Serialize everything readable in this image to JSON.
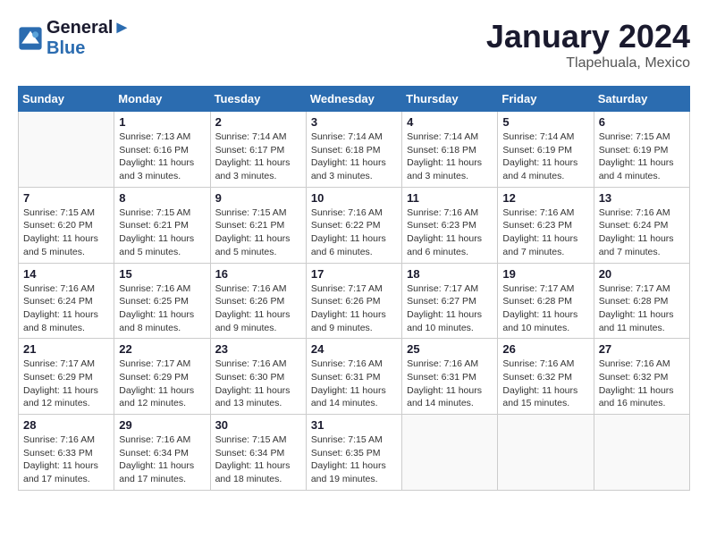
{
  "header": {
    "logo_line1": "General",
    "logo_line2": "Blue",
    "month": "January 2024",
    "location": "Tlapehuala, Mexico"
  },
  "columns": [
    "Sunday",
    "Monday",
    "Tuesday",
    "Wednesday",
    "Thursday",
    "Friday",
    "Saturday"
  ],
  "weeks": [
    [
      {
        "day": "",
        "sunrise": "",
        "sunset": "",
        "daylight": ""
      },
      {
        "day": "1",
        "sunrise": "Sunrise: 7:13 AM",
        "sunset": "Sunset: 6:16 PM",
        "daylight": "Daylight: 11 hours and 3 minutes."
      },
      {
        "day": "2",
        "sunrise": "Sunrise: 7:14 AM",
        "sunset": "Sunset: 6:17 PM",
        "daylight": "Daylight: 11 hours and 3 minutes."
      },
      {
        "day": "3",
        "sunrise": "Sunrise: 7:14 AM",
        "sunset": "Sunset: 6:18 PM",
        "daylight": "Daylight: 11 hours and 3 minutes."
      },
      {
        "day": "4",
        "sunrise": "Sunrise: 7:14 AM",
        "sunset": "Sunset: 6:18 PM",
        "daylight": "Daylight: 11 hours and 3 minutes."
      },
      {
        "day": "5",
        "sunrise": "Sunrise: 7:14 AM",
        "sunset": "Sunset: 6:19 PM",
        "daylight": "Daylight: 11 hours and 4 minutes."
      },
      {
        "day": "6",
        "sunrise": "Sunrise: 7:15 AM",
        "sunset": "Sunset: 6:19 PM",
        "daylight": "Daylight: 11 hours and 4 minutes."
      }
    ],
    [
      {
        "day": "7",
        "sunrise": "Sunrise: 7:15 AM",
        "sunset": "Sunset: 6:20 PM",
        "daylight": "Daylight: 11 hours and 5 minutes."
      },
      {
        "day": "8",
        "sunrise": "Sunrise: 7:15 AM",
        "sunset": "Sunset: 6:21 PM",
        "daylight": "Daylight: 11 hours and 5 minutes."
      },
      {
        "day": "9",
        "sunrise": "Sunrise: 7:15 AM",
        "sunset": "Sunset: 6:21 PM",
        "daylight": "Daylight: 11 hours and 5 minutes."
      },
      {
        "day": "10",
        "sunrise": "Sunrise: 7:16 AM",
        "sunset": "Sunset: 6:22 PM",
        "daylight": "Daylight: 11 hours and 6 minutes."
      },
      {
        "day": "11",
        "sunrise": "Sunrise: 7:16 AM",
        "sunset": "Sunset: 6:23 PM",
        "daylight": "Daylight: 11 hours and 6 minutes."
      },
      {
        "day": "12",
        "sunrise": "Sunrise: 7:16 AM",
        "sunset": "Sunset: 6:23 PM",
        "daylight": "Daylight: 11 hours and 7 minutes."
      },
      {
        "day": "13",
        "sunrise": "Sunrise: 7:16 AM",
        "sunset": "Sunset: 6:24 PM",
        "daylight": "Daylight: 11 hours and 7 minutes."
      }
    ],
    [
      {
        "day": "14",
        "sunrise": "Sunrise: 7:16 AM",
        "sunset": "Sunset: 6:24 PM",
        "daylight": "Daylight: 11 hours and 8 minutes."
      },
      {
        "day": "15",
        "sunrise": "Sunrise: 7:16 AM",
        "sunset": "Sunset: 6:25 PM",
        "daylight": "Daylight: 11 hours and 8 minutes."
      },
      {
        "day": "16",
        "sunrise": "Sunrise: 7:16 AM",
        "sunset": "Sunset: 6:26 PM",
        "daylight": "Daylight: 11 hours and 9 minutes."
      },
      {
        "day": "17",
        "sunrise": "Sunrise: 7:17 AM",
        "sunset": "Sunset: 6:26 PM",
        "daylight": "Daylight: 11 hours and 9 minutes."
      },
      {
        "day": "18",
        "sunrise": "Sunrise: 7:17 AM",
        "sunset": "Sunset: 6:27 PM",
        "daylight": "Daylight: 11 hours and 10 minutes."
      },
      {
        "day": "19",
        "sunrise": "Sunrise: 7:17 AM",
        "sunset": "Sunset: 6:28 PM",
        "daylight": "Daylight: 11 hours and 10 minutes."
      },
      {
        "day": "20",
        "sunrise": "Sunrise: 7:17 AM",
        "sunset": "Sunset: 6:28 PM",
        "daylight": "Daylight: 11 hours and 11 minutes."
      }
    ],
    [
      {
        "day": "21",
        "sunrise": "Sunrise: 7:17 AM",
        "sunset": "Sunset: 6:29 PM",
        "daylight": "Daylight: 11 hours and 12 minutes."
      },
      {
        "day": "22",
        "sunrise": "Sunrise: 7:17 AM",
        "sunset": "Sunset: 6:29 PM",
        "daylight": "Daylight: 11 hours and 12 minutes."
      },
      {
        "day": "23",
        "sunrise": "Sunrise: 7:16 AM",
        "sunset": "Sunset: 6:30 PM",
        "daylight": "Daylight: 11 hours and 13 minutes."
      },
      {
        "day": "24",
        "sunrise": "Sunrise: 7:16 AM",
        "sunset": "Sunset: 6:31 PM",
        "daylight": "Daylight: 11 hours and 14 minutes."
      },
      {
        "day": "25",
        "sunrise": "Sunrise: 7:16 AM",
        "sunset": "Sunset: 6:31 PM",
        "daylight": "Daylight: 11 hours and 14 minutes."
      },
      {
        "day": "26",
        "sunrise": "Sunrise: 7:16 AM",
        "sunset": "Sunset: 6:32 PM",
        "daylight": "Daylight: 11 hours and 15 minutes."
      },
      {
        "day": "27",
        "sunrise": "Sunrise: 7:16 AM",
        "sunset": "Sunset: 6:32 PM",
        "daylight": "Daylight: 11 hours and 16 minutes."
      }
    ],
    [
      {
        "day": "28",
        "sunrise": "Sunrise: 7:16 AM",
        "sunset": "Sunset: 6:33 PM",
        "daylight": "Daylight: 11 hours and 17 minutes."
      },
      {
        "day": "29",
        "sunrise": "Sunrise: 7:16 AM",
        "sunset": "Sunset: 6:34 PM",
        "daylight": "Daylight: 11 hours and 17 minutes."
      },
      {
        "day": "30",
        "sunrise": "Sunrise: 7:15 AM",
        "sunset": "Sunset: 6:34 PM",
        "daylight": "Daylight: 11 hours and 18 minutes."
      },
      {
        "day": "31",
        "sunrise": "Sunrise: 7:15 AM",
        "sunset": "Sunset: 6:35 PM",
        "daylight": "Daylight: 11 hours and 19 minutes."
      },
      {
        "day": "",
        "sunrise": "",
        "sunset": "",
        "daylight": ""
      },
      {
        "day": "",
        "sunrise": "",
        "sunset": "",
        "daylight": ""
      },
      {
        "day": "",
        "sunrise": "",
        "sunset": "",
        "daylight": ""
      }
    ]
  ]
}
